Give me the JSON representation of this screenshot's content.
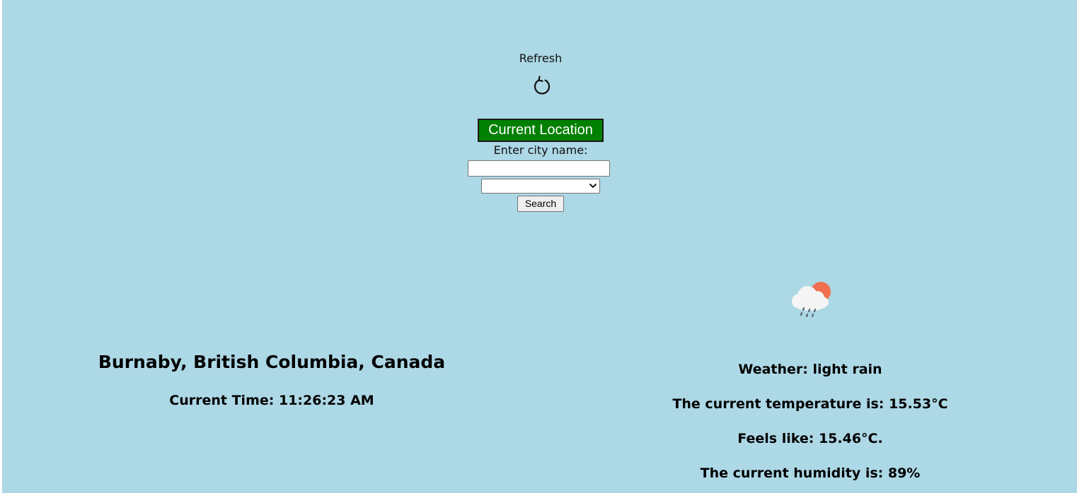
{
  "controls": {
    "refresh_label": "Refresh",
    "refresh_icon": "refresh-arrow-icon",
    "current_location_label": "Current Location",
    "city_label": "Enter city name:",
    "city_value": "",
    "country_selected": "",
    "search_label": "Search"
  },
  "location": {
    "name": "Burnaby, British Columbia, Canada",
    "current_time": "Current Time: 11:26:23 AM"
  },
  "weather": {
    "icon": "light-rain-icon",
    "description": "Weather: light rain",
    "temperature": "The current temperature is: 15.53°C",
    "feels_like": "Feels like: 15.46°C.",
    "humidity": "The current humidity is: 89%"
  },
  "colors": {
    "background": "#add8e6",
    "location_button": "#008000",
    "sun": "#f07050"
  }
}
